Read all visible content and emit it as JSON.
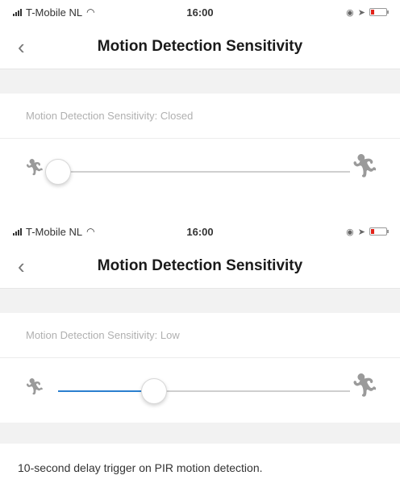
{
  "colors": {
    "accent": "#2a7fcf",
    "battery": "#e2231a",
    "band": "#f2f2f2"
  },
  "screens": [
    {
      "status": {
        "carrier": "T-Mobile NL",
        "time": "16:00"
      },
      "nav": {
        "back_icon": "chevron-left-icon",
        "title": "Motion Detection Sensitivity"
      },
      "setting_label": "Motion Detection Sensitivity: Closed",
      "slider": {
        "min_icon": "runner-icon",
        "max_icon": "runner-icon",
        "value": 0
      }
    },
    {
      "status": {
        "carrier": "T-Mobile NL",
        "time": "16:00"
      },
      "nav": {
        "back_icon": "chevron-left-icon",
        "title": "Motion Detection Sensitivity"
      },
      "setting_label": "Motion Detection Sensitivity: Low",
      "slider": {
        "min_icon": "runner-icon",
        "max_icon": "runner-icon",
        "value": 0.33
      },
      "description": "10-second delay trigger on PIR motion detection."
    }
  ]
}
